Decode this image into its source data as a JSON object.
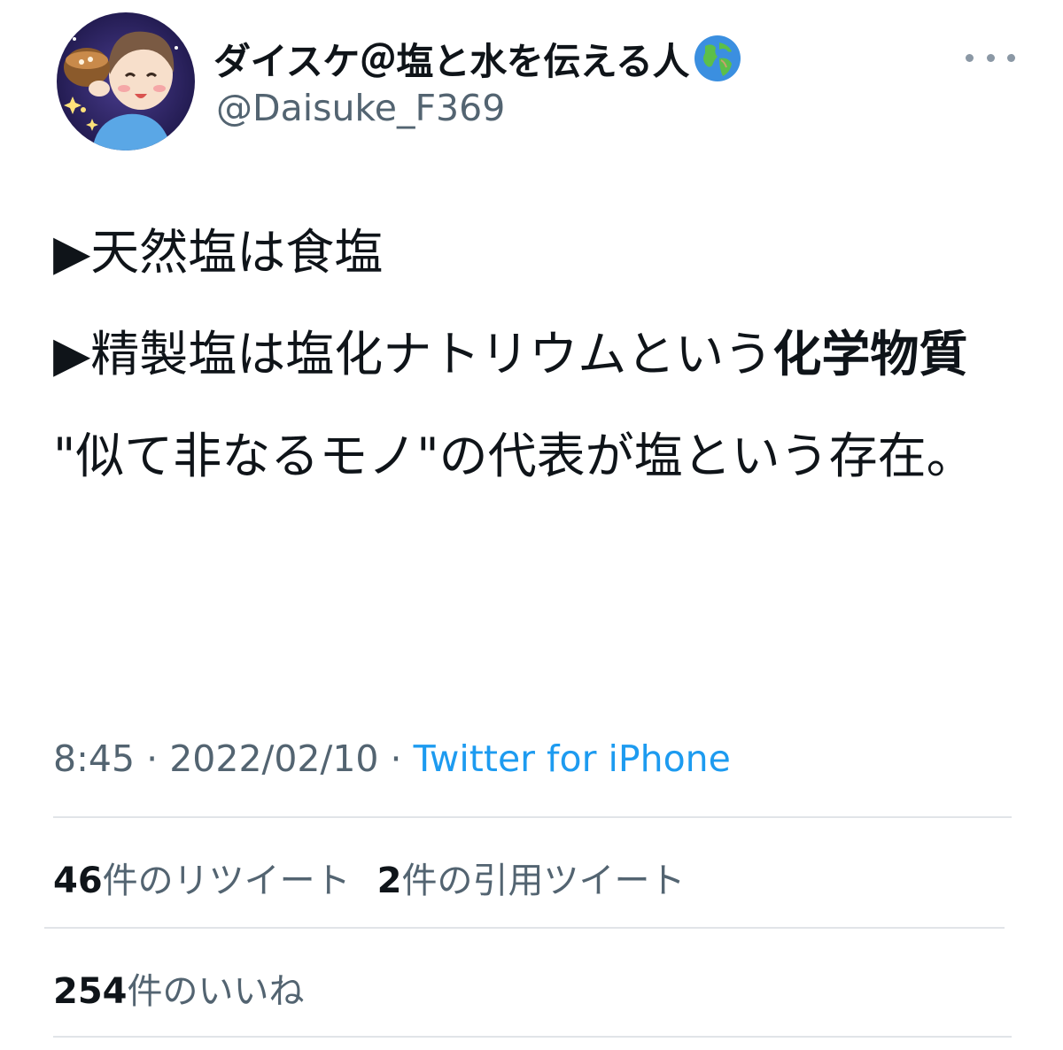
{
  "author": {
    "display_name": "ダイスケ＠塩と水を伝える人",
    "handle": "@Daisuke_F369",
    "name_emoji": "globe-africa-europe-icon"
  },
  "tweet": {
    "line1": "▶天然塩は食塩",
    "line2_plain": "▶精製塩は塩化ナトリウムという",
    "line2_bold": "化学物質",
    "line3": "\"似て非なるモノ\"の代表が塩という存在。"
  },
  "meta": {
    "time": "8:45",
    "separator1": " · ",
    "date": "2022/02/10",
    "separator2": " · ",
    "source": "Twitter for iPhone"
  },
  "stats": {
    "retweets_count": "46",
    "retweets_label": "件のリツイート",
    "quotes_count": "2",
    "quotes_label": "件の引用ツイート",
    "likes_count": "254",
    "likes_label": "件のいいね"
  },
  "colors": {
    "text_primary": "#0f1419",
    "text_secondary": "#536471",
    "link_blue": "#1d9bf0",
    "divider": "#e1e4e8"
  }
}
